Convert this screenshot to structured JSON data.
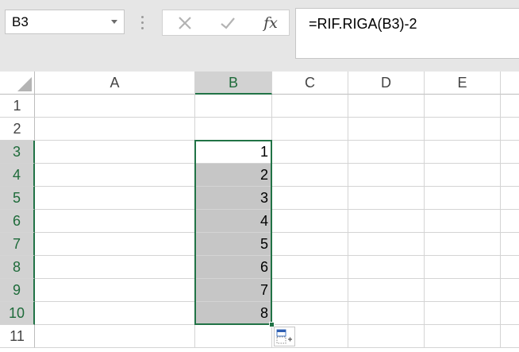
{
  "name_box": {
    "value": "B3"
  },
  "formula_bar": {
    "cancel_icon": "x-icon",
    "enter_icon": "checkmark-icon",
    "function_label": "fx",
    "formula": "=RIF.RIGA(B3)-2"
  },
  "sheet": {
    "columns": [
      "A",
      "B",
      "C",
      "D",
      "E"
    ],
    "selected_column": "B",
    "rows": [
      "1",
      "2",
      "3",
      "4",
      "5",
      "6",
      "7",
      "8",
      "9",
      "10",
      "11"
    ],
    "selected_rows": [
      "3",
      "4",
      "5",
      "6",
      "7",
      "8",
      "9",
      "10"
    ],
    "selection_range": "B3:B10",
    "column_b_values": {
      "3": "1",
      "4": "2",
      "5": "3",
      "6": "4",
      "7": "5",
      "8": "6",
      "9": "7",
      "10": "8"
    }
  },
  "colors": {
    "accent_green": "#217346",
    "selection_fill": "#c6c6c6",
    "header_selected": "#d2d2d2"
  },
  "autofill_options_icon": "paste-options-icon"
}
